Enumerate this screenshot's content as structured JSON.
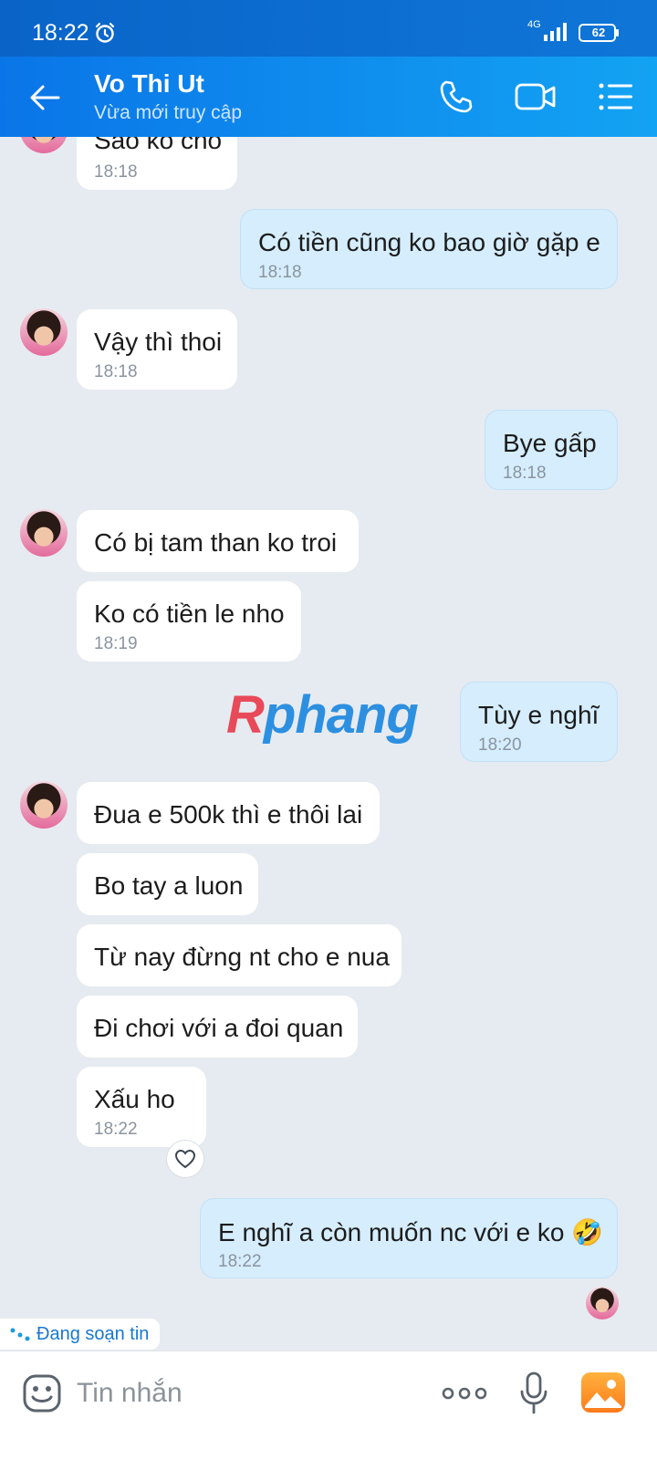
{
  "status_bar": {
    "time": "18:22",
    "network": "4G",
    "battery": "62"
  },
  "header": {
    "contact_name": "Vo Thi Ut",
    "contact_status": "Vừa mới truy cập"
  },
  "messages": [
    {
      "dir": "in",
      "text": "Sao ko cho",
      "time": "18:18"
    },
    {
      "dir": "out",
      "text": "Có tiền cũng ko bao giờ gặp e",
      "time": "18:18"
    },
    {
      "dir": "in",
      "text": "Vậy thì thoi",
      "time": "18:18"
    },
    {
      "dir": "out",
      "text": "Bye gấp",
      "time": "18:18"
    },
    {
      "dir": "in",
      "text": "Có bị tam than ko troi",
      "time": ""
    },
    {
      "dir": "in",
      "text": "Ko có tiền le nho",
      "time": "18:19"
    },
    {
      "dir": "out",
      "text": "Tùy e nghĩ",
      "time": "18:20"
    },
    {
      "dir": "in",
      "text": "Đua e 500k thì e thôi lai",
      "time": ""
    },
    {
      "dir": "in",
      "text": "Bo tay a luon",
      "time": ""
    },
    {
      "dir": "in",
      "text": "Từ nay đừng nt cho e nua",
      "time": ""
    },
    {
      "dir": "in",
      "text": "Đi chơi với a đoi quan",
      "time": ""
    },
    {
      "dir": "in",
      "text": "Xấu ho",
      "time": "18:22"
    },
    {
      "dir": "out",
      "text": "E nghĩ a còn muốn nc với e ko 🤣",
      "time": "18:22"
    }
  ],
  "watermark": {
    "first": "R",
    "rest": "phang"
  },
  "typing": {
    "label": "Đang soạn tin"
  },
  "composer": {
    "placeholder": "Tin nhắn"
  },
  "colors": {
    "header_start": "#0a75e8",
    "header_end": "#13a3f3",
    "incoming": "#ffffff",
    "outgoing": "#d5edfd",
    "accent": "#1777d2"
  },
  "icons": [
    "alarm-icon",
    "signal-icon",
    "battery-icon",
    "back-icon",
    "call-icon",
    "video-call-icon",
    "menu-icon",
    "heart-icon",
    "emoji-icon",
    "more-icon",
    "mic-icon",
    "image-icon"
  ]
}
